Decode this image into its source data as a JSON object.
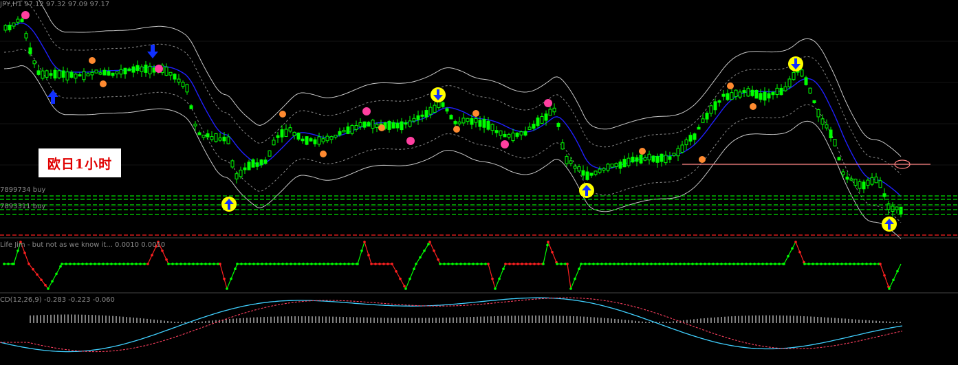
{
  "window": {
    "symbol_label": "JPY,H1",
    "ohlc_text": "97.12 97.32 97.09 97.17",
    "annotation": "欧日1小时"
  },
  "level_labels": [
    "7899734 buy",
    "7893311 buy"
  ],
  "indicator_label": "Life Jim - but not as we know it... 0.0010 0.0010",
  "macd_label": "CD(12,26,9) -0.283 -0.223 -0.060",
  "colors": {
    "background": "#000000",
    "candle_up": "#00ff00",
    "ma_line": "#2020ff",
    "band_outer": "#c8c8c8",
    "band_inner": "#8a8a8a",
    "level_line": "#00e000",
    "red_hline": "#ff2020",
    "support_line": "#ff8080",
    "osc_up": "#00ff00",
    "osc_down": "#ff2020",
    "macd_main": "#40d0ff",
    "macd_signal": "#ff4060",
    "hist": "#ffffff",
    "arrow_blue": "#1030ff",
    "marker_yellow": "#ffff00",
    "dot_orange": "#ff8a30",
    "dot_magenta": "#ff3fa0"
  },
  "chart_data": [
    {
      "type": "candlestick",
      "title": "JPY,H1",
      "bands": [
        "ma",
        "inner_band",
        "outer_band"
      ],
      "approx_closes": [
        97.6,
        97.4,
        97.1,
        97.0,
        97.1,
        97.0,
        97.0,
        96.4,
        96.1,
        96.6,
        96.5,
        96.6,
        96.7,
        96.6,
        96.5,
        96.7,
        96.4,
        96.5,
        96.4,
        96.6,
        96.7,
        96.6,
        96.8,
        96.7,
        96.6,
        96.3,
        96.1,
        95.9
      ],
      "horizontal_levels": [
        "7899734 buy",
        "7893311 buy"
      ],
      "markers": {
        "buy_arrows": 5,
        "sell_arrows": 4
      }
    },
    {
      "type": "line",
      "title": "Life Jim - but not as we know it...",
      "levels": [
        0.001,
        0.001
      ],
      "states": [
        "up",
        "down",
        "up",
        "down",
        "up",
        "down",
        "up",
        "down",
        "up"
      ]
    },
    {
      "type": "area",
      "title": "CD(12,26,9)",
      "values": {
        "main": -0.283,
        "signal": -0.223,
        "histogram": -0.06
      }
    }
  ]
}
